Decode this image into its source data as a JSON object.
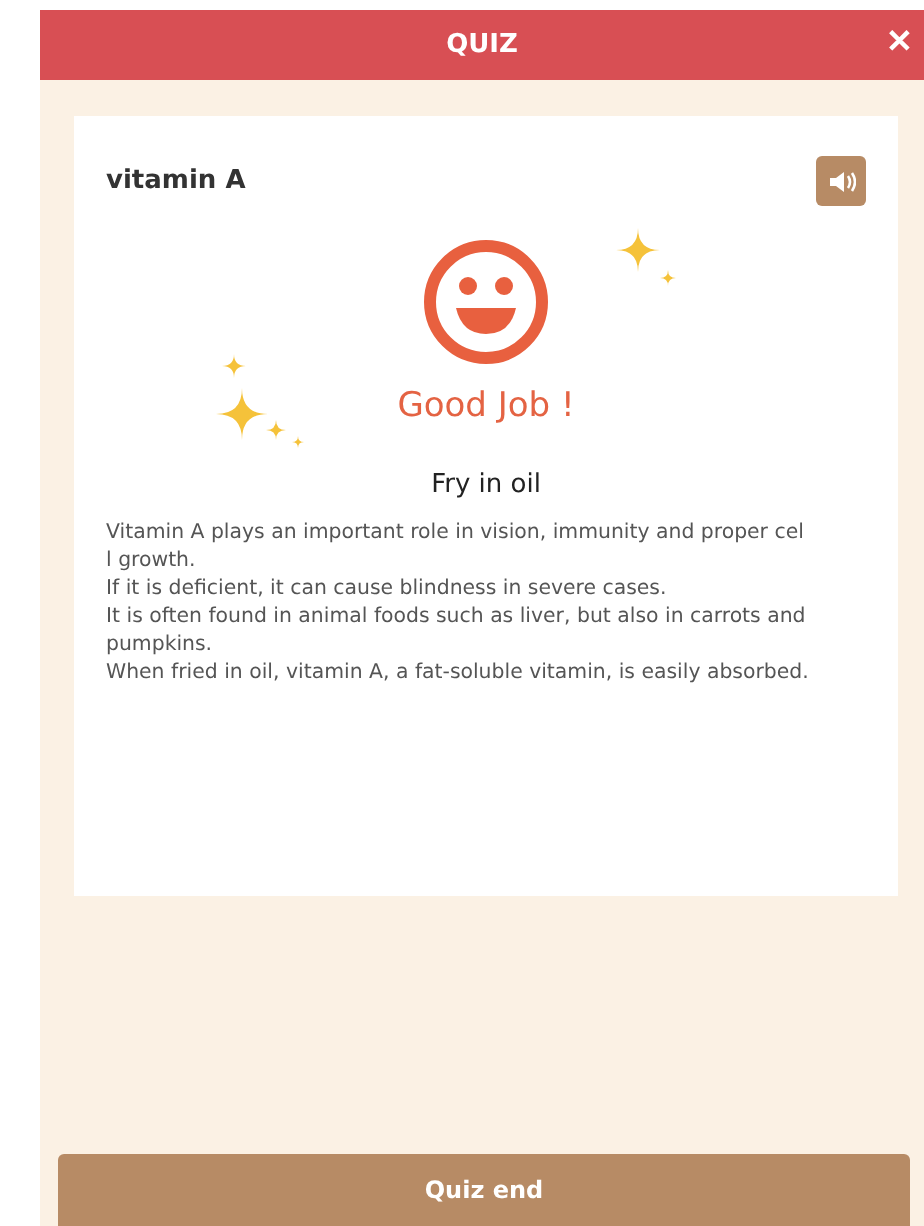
{
  "window": {
    "title": "QUIZ",
    "close": "✕"
  },
  "card": {
    "term": "vitamin A",
    "result": "Good Job !",
    "answer": "Fry in oil",
    "explanation": [
      "Vitamin A plays an important role in vision, immunity and proper cel",
      "l growth.",
      "If it is deficient, it can cause blindness in severe cases.",
      "It is often found in animal foods such as liver, but also in carrots and",
      "pumpkins.",
      "When fried in oil, vitamin A, a fat-soluble vitamin, is easily absorbed."
    ]
  },
  "buttons": [
    "Quiz end"
  ]
}
